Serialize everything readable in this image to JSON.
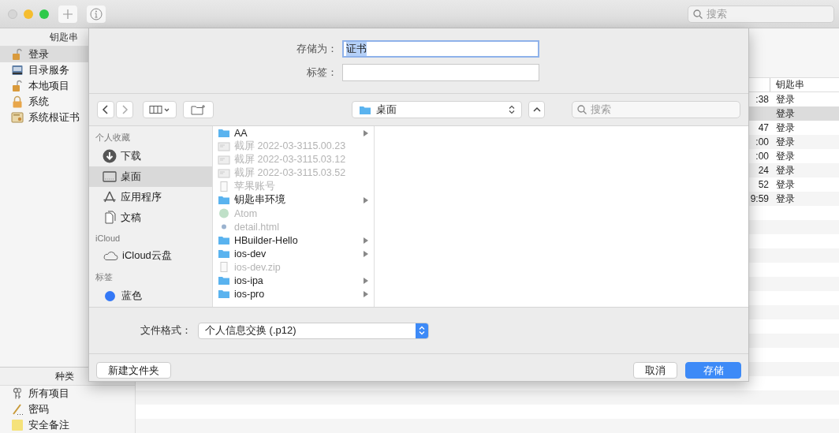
{
  "window": {
    "search": {
      "placeholder": "搜索"
    }
  },
  "keychains": {
    "title": "钥匙串",
    "items": [
      {
        "label": "登录",
        "kind": "lock-open",
        "selected": true
      },
      {
        "label": "目录服务",
        "kind": "drive",
        "selected": false
      },
      {
        "label": "本地项目",
        "kind": "lock-open",
        "selected": false
      },
      {
        "label": "系统",
        "kind": "lock",
        "selected": false
      },
      {
        "label": "系统根证书",
        "kind": "certificate",
        "selected": false
      }
    ]
  },
  "categories": {
    "title": "种类",
    "items": [
      {
        "label": "所有项目",
        "kind": "keys"
      },
      {
        "label": "密码",
        "kind": "pen"
      },
      {
        "label": "安全备注",
        "kind": "note"
      }
    ]
  },
  "table": {
    "columns": [
      {
        "label": "钥匙串"
      }
    ],
    "rows": [
      {
        "time": ":38",
        "keychain": "登录",
        "selected": false
      },
      {
        "keychain": "登录",
        "selected": true
      },
      {
        "time": "47",
        "keychain": "登录",
        "selected": false
      },
      {
        "time": ":00",
        "keychain": "登录",
        "selected": false
      },
      {
        "time": ":00",
        "keychain": "登录",
        "selected": false
      },
      {
        "time": "24",
        "keychain": "登录",
        "selected": false
      },
      {
        "time": "52",
        "keychain": "登录",
        "selected": false
      },
      {
        "time": "9:59",
        "keychain": "登录",
        "selected": false
      }
    ]
  },
  "dialog": {
    "save_as": {
      "label": "存储为：",
      "value": "证书"
    },
    "tags": {
      "label": "标签："
    },
    "location": "桌面",
    "search": {
      "placeholder": "搜索"
    },
    "sidebar": [
      {
        "title": "个人收藏",
        "items": [
          {
            "label": "下载",
            "kind": "download",
            "selected": false
          },
          {
            "label": "桌面",
            "kind": "desktop",
            "selected": true
          },
          {
            "label": "应用程序",
            "kind": "apps",
            "selected": false
          },
          {
            "label": "文稿",
            "kind": "documents",
            "selected": false
          }
        ]
      },
      {
        "title": "iCloud",
        "items": [
          {
            "label": "iCloud云盘",
            "kind": "cloud",
            "selected": false
          }
        ]
      },
      {
        "title": "标签",
        "items": [
          {
            "label": "蓝色",
            "kind": "tag",
            "color": "#3478f6",
            "selected": false
          }
        ]
      }
    ],
    "files": [
      {
        "name": "AA",
        "kind": "folder",
        "disabled": false
      },
      {
        "name": "截屏 2022-03-3115.00.23",
        "kind": "image",
        "disabled": true
      },
      {
        "name": "截屏 2022-03-3115.03.12",
        "kind": "image",
        "disabled": true
      },
      {
        "name": "截屏 2022-03-3115.03.52",
        "kind": "image",
        "disabled": true
      },
      {
        "name": "苹果账号",
        "kind": "document",
        "disabled": true
      },
      {
        "name": "钥匙串环境",
        "kind": "folder",
        "disabled": false
      },
      {
        "name": "Atom",
        "kind": "app",
        "disabled": true
      },
      {
        "name": "detail.html",
        "kind": "web",
        "disabled": true
      },
      {
        "name": "HBuilder-Hello",
        "kind": "folder",
        "disabled": false
      },
      {
        "name": "ios-dev",
        "kind": "folder",
        "disabled": false
      },
      {
        "name": "ios-dev.zip",
        "kind": "document",
        "disabled": true
      },
      {
        "name": "ios-ipa",
        "kind": "folder",
        "disabled": false
      },
      {
        "name": "ios-pro",
        "kind": "folder",
        "disabled": false
      }
    ],
    "format": {
      "label": "文件格式：",
      "value": "个人信息交换 (.p12)"
    },
    "buttons": {
      "new_folder": "新建文件夹",
      "cancel": "取消",
      "save": "存储"
    }
  }
}
